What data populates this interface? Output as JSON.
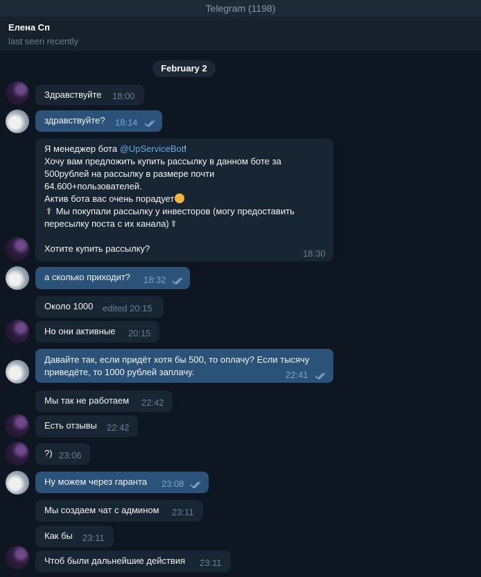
{
  "window": {
    "title": "Telegram (1198)"
  },
  "contact": {
    "name": "Елена Сп",
    "status": "last seen recently"
  },
  "date_separator": "February 2",
  "messages": [
    {
      "text": "Здравствуйте",
      "time": "18:00"
    },
    {
      "text": "здравствуйте?",
      "time": "18:14"
    },
    {
      "line1_pre": "Я менеджер бота ",
      "line1_link": "@UpServiceBot",
      "line1_post": "!",
      "line2": "Хочу вам предложить купить рассылку в данном боте за",
      "line3": "500рублей на рассылку в размере почти",
      "line4": "64.600+пользователей.",
      "line5": "Актив бота вас очень порадует",
      "line6": " Мы покупали рассылку у инвесторов (могу предоставить",
      "line7": "пересылку поста с их канала)",
      "line9": "Хотите купить рассылку?",
      "time": "18:30"
    },
    {
      "text": "а сколько приходит?",
      "time": "18:32"
    },
    {
      "text": "Около 1000",
      "time": "edited 20:15"
    },
    {
      "text": "Но они активные",
      "time": "20:15"
    },
    {
      "line1": "Давайте так, если придёт хотя бы 500, то оплачу? Если тысячу",
      "line2": "приведёте, то 1000 рублей заплачу.",
      "time": "22:41"
    },
    {
      "text": "Мы так не работаем",
      "time": "22:42"
    },
    {
      "text": "Есть отзывы",
      "time": "22:42"
    },
    {
      "text": "?)",
      "time": "23:06"
    },
    {
      "text": "Ну можем через гаранта",
      "time": "23:08"
    },
    {
      "text": "Мы создаем чат с админом",
      "time": "23:11"
    },
    {
      "text": "Как бы",
      "time": "23:11"
    },
    {
      "text": "Чтоб были дальнейшие действия",
      "time": "23:11"
    }
  ],
  "colors": {
    "background": "#0e1621",
    "incoming_bubble": "#182533",
    "outgoing_bubble": "#2b5278",
    "link": "#63aee8",
    "read_ticks": "#5fa7e8"
  }
}
